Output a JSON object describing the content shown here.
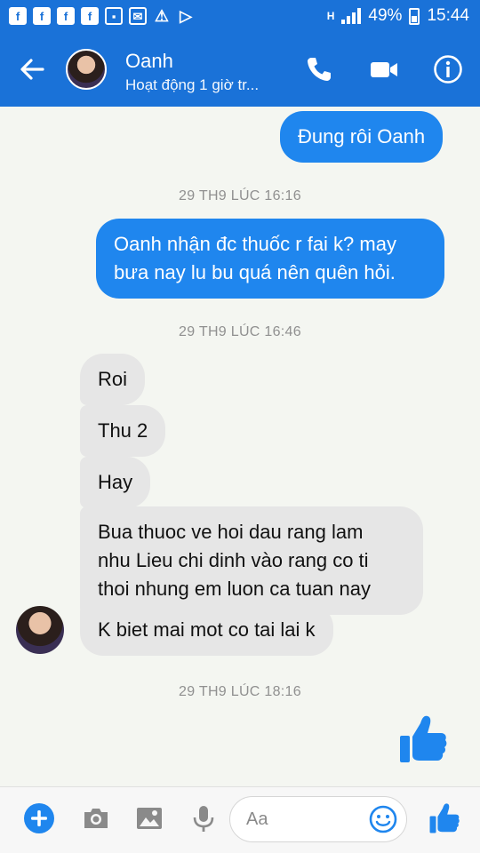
{
  "status_bar": {
    "notification_icons": [
      "facebook-icon",
      "facebook-icon",
      "facebook-icon",
      "facebook-icon",
      "gallery-icon",
      "mail-icon",
      "warning-icon",
      "play-store-icon"
    ],
    "network": "H",
    "battery": "49%",
    "time": "15:44"
  },
  "header": {
    "name": "Oanh",
    "status": "Hoạt động 1 giờ tr..."
  },
  "messages": {
    "m1": "Đung rôi Oanh",
    "ts1": "29 TH9 LÚC 16:16",
    "m2_l1": "Oanh nhận đc thuốc r fai k? may",
    "m2_l2": "bưa nay lu bu quá nên quên hỏi.",
    "ts2": "29 TH9 LÚC 16:46",
    "m3": "Roi",
    "m4": "Thu 2",
    "m5": "Hay",
    "m6_l1": "Bua thuoc ve hoi dau rang lam",
    "m6_l2": "nhu Lieu chi dinh vào rang co ti",
    "m6_l3": "thoi nhung em luon ca tuan nay",
    "m7": "K biet mai mot co tai lai k",
    "ts3": "29 TH9 LÚC 18:16"
  },
  "composer": {
    "placeholder": "Aa"
  },
  "colors": {
    "brand_blue": "#1a72d8",
    "outgoing_bubble": "#1f86ee",
    "incoming_bubble": "#e6e6e6"
  }
}
